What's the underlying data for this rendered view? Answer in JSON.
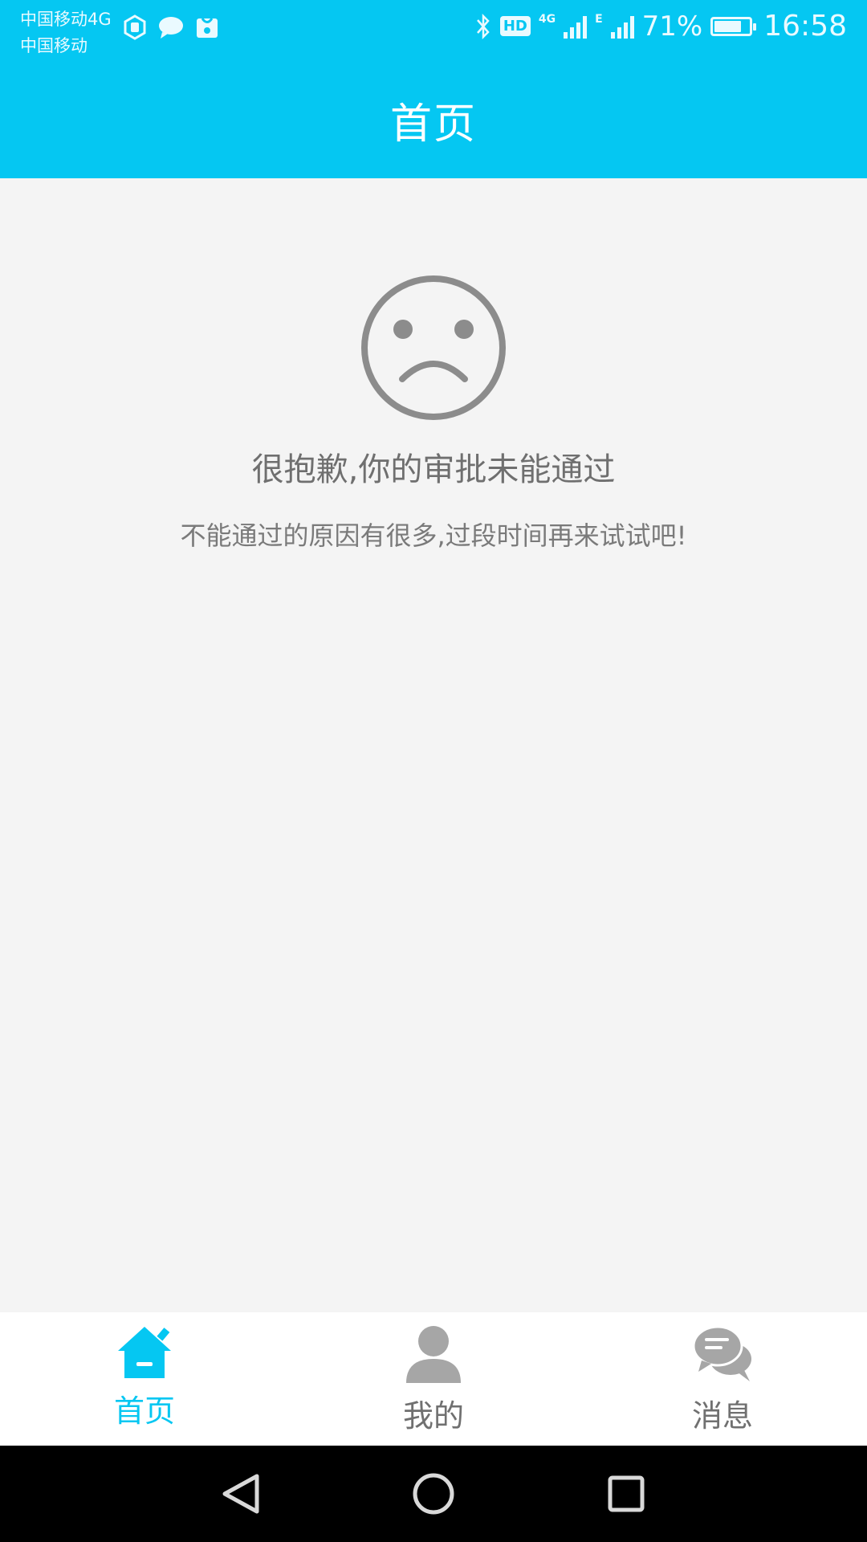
{
  "status_bar": {
    "carrier_primary": "中国移动4G",
    "carrier_secondary": "中国移动",
    "battery_percent": "71%",
    "battery_level": 0.71,
    "time": "16:58",
    "hd_badge": "HD",
    "network_4g": "4G",
    "network_e": "E",
    "icons": [
      "app-hex-icon",
      "chat-bubble-icon",
      "huawei-store-icon",
      "bluetooth-icon",
      "hd-icon",
      "signal-4g-icon",
      "signal-e-icon",
      "battery-icon"
    ]
  },
  "header": {
    "title": "首页"
  },
  "empty_state": {
    "icon": "sad-face-icon",
    "headline": "很抱歉,你的审批未能通过",
    "message": "不能通过的原因有很多,过段时间再来试试吧!"
  },
  "tabbar": {
    "tabs": [
      {
        "label": "首页",
        "icon": "home-icon",
        "active": true
      },
      {
        "label": "我的",
        "icon": "person-icon",
        "active": false
      },
      {
        "label": "消息",
        "icon": "chat-icon",
        "active": false
      }
    ]
  },
  "colors": {
    "accent": "#05c7f2",
    "background": "#f4f4f4",
    "inactive_icon": "#a6a6a6",
    "text_gray": "#6f6f6f"
  },
  "nav_bar": {
    "buttons": [
      "back-icon",
      "home-circle-icon",
      "recents-icon"
    ]
  }
}
